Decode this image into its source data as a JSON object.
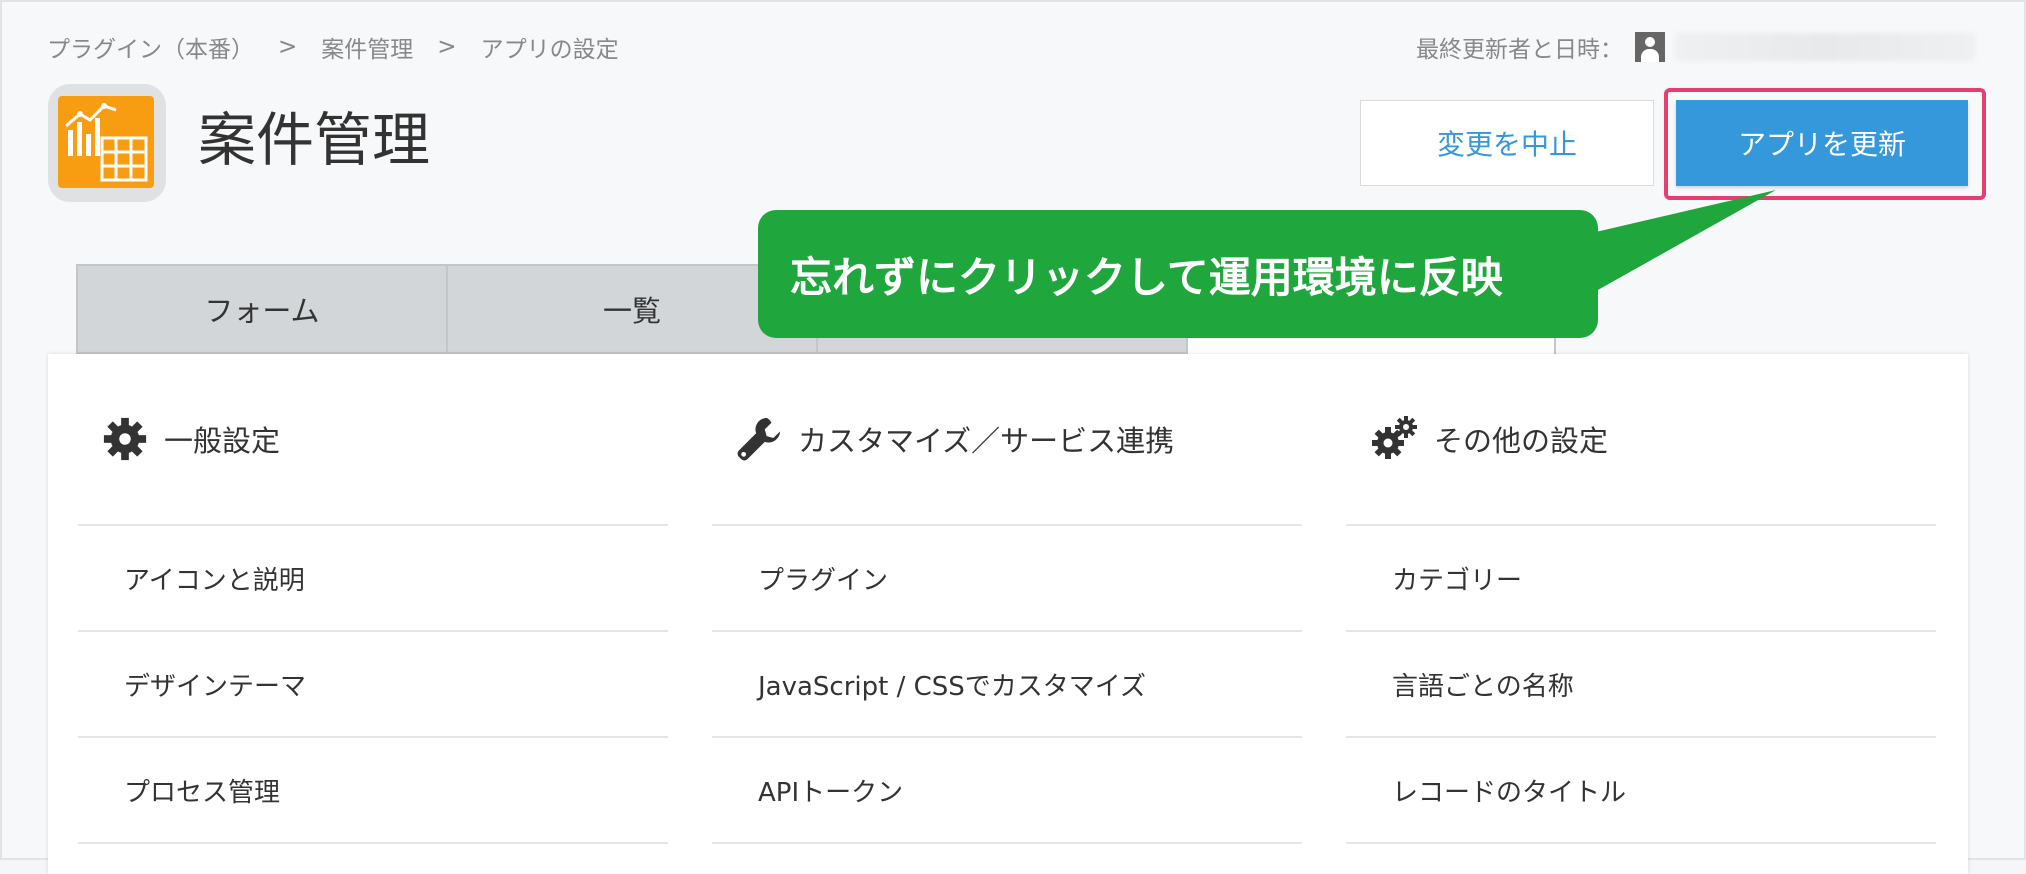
{
  "breadcrumb": [
    "プラグイン（本番）",
    "案件管理",
    "アプリの設定"
  ],
  "breadcrumb_sep": ">",
  "updater": {
    "label": "最終更新者と日時："
  },
  "app": {
    "name": "案件管理"
  },
  "actions": {
    "cancel_label": "変更を中止",
    "update_label": "アプリを更新"
  },
  "callout": {
    "text": "忘れずにクリックして運用環境に反映"
  },
  "tabs": [
    {
      "label": "フォーム"
    },
    {
      "label": "一覧"
    },
    {
      "label": ""
    },
    {
      "label": ""
    }
  ],
  "columns": [
    {
      "icon": "gear-icon",
      "title": "一般設定",
      "items": [
        "アイコンと説明",
        "デザインテーマ",
        "プロセス管理"
      ]
    },
    {
      "icon": "wrench-icon",
      "title": "カスタマイズ／サービス連携",
      "items": [
        "プラグイン",
        "JavaScript / CSSでカスタマイズ",
        "APIトークン"
      ]
    },
    {
      "icon": "gears-icon",
      "title": "その他の設定",
      "items": [
        "カテゴリー",
        "言語ごとの名称",
        "レコードのタイトル"
      ]
    }
  ],
  "colors": {
    "primary": "#3498db",
    "highlight": "#e63e70",
    "callout": "#1fa73d",
    "app_icon": "#f89d12"
  }
}
